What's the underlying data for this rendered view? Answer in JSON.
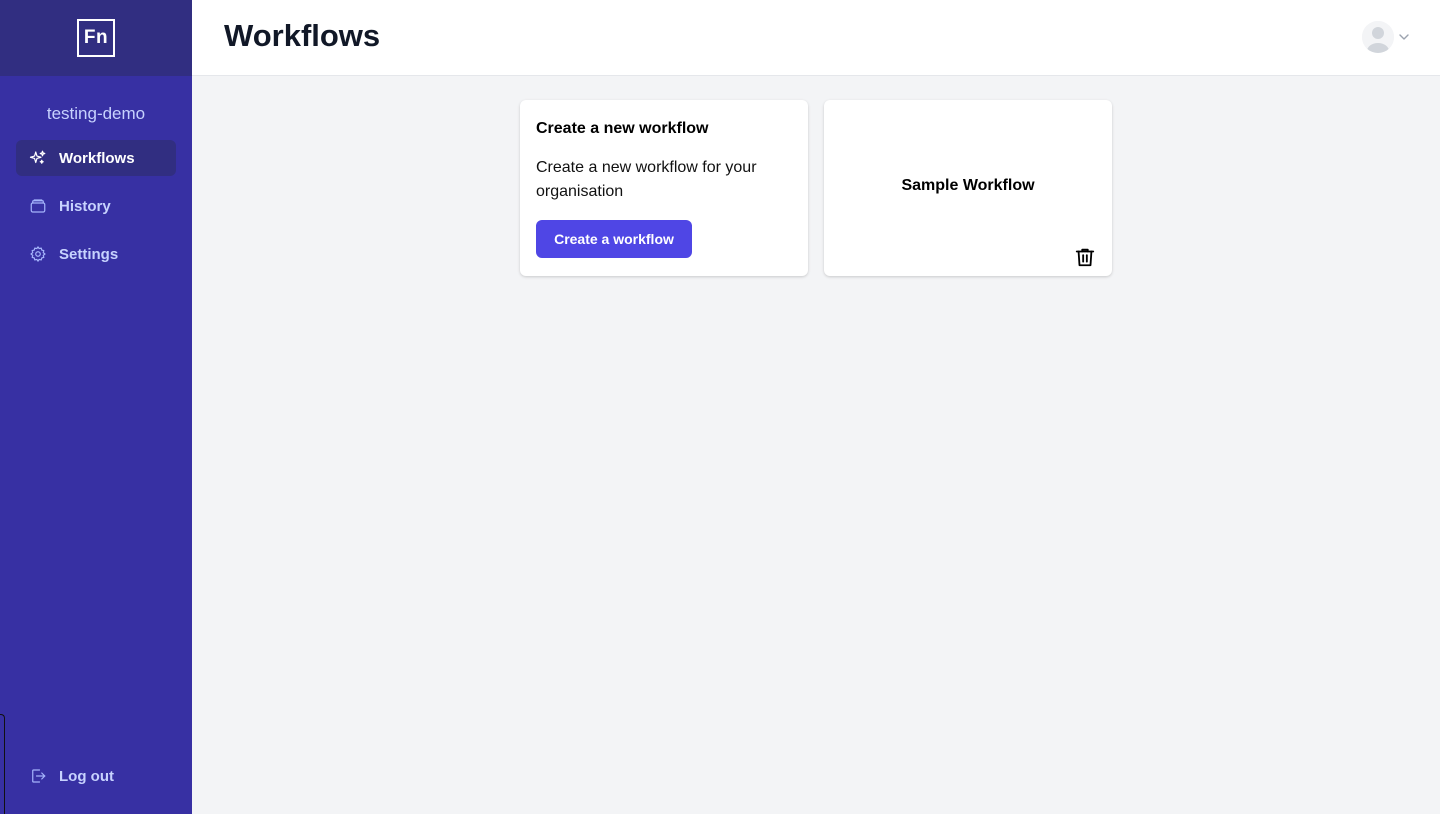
{
  "logo": {
    "text": "Fn"
  },
  "org": {
    "name": "testing-demo"
  },
  "sidebar": {
    "items": [
      {
        "label": "Workflows",
        "icon": "sparkles-icon",
        "active": true
      },
      {
        "label": "History",
        "icon": "archive-icon",
        "active": false
      },
      {
        "label": "Settings",
        "icon": "gear-icon",
        "active": false
      }
    ],
    "logout_label": "Log out"
  },
  "header": {
    "title": "Workflows"
  },
  "create_card": {
    "title": "Create a new workflow",
    "description": "Create a new workflow for your organisation",
    "button_label": "Create a workflow"
  },
  "workflows": [
    {
      "name": "Sample Workflow"
    }
  ],
  "colors": {
    "sidebar_bg": "#3730a3",
    "sidebar_header_bg": "#312e81",
    "accent": "#4f46e5",
    "page_bg": "#f3f4f6"
  }
}
